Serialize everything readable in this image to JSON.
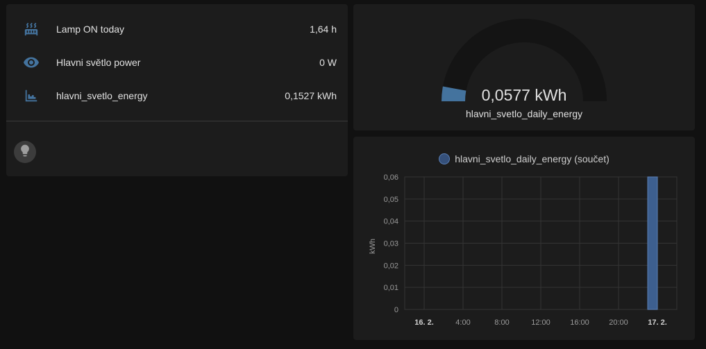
{
  "entities": {
    "rows": [
      {
        "name": "Lamp ON today",
        "state": "1,64 h",
        "icon": "radiator-icon"
      },
      {
        "name": "Hlavni světlo power",
        "state": "0 W",
        "icon": "eye-icon"
      },
      {
        "name": "hlavni_svetlo_energy",
        "state": "0,1527 kWh",
        "icon": "chart-step-icon"
      }
    ],
    "toggle_icon": "lightbulb-icon"
  },
  "gauge": {
    "value_text": "0,0577 kWh",
    "name": "hlavni_svetlo_daily_energy",
    "value": 0.0577,
    "min": 0,
    "max": 1
  },
  "chart": {
    "legend": "hlavni_svetlo_daily_energy (součet)",
    "ylabel": "kWh",
    "yticks": [
      "0",
      "0,01",
      "0,02",
      "0,03",
      "0,04",
      "0,05",
      "0,06"
    ],
    "xticks": [
      "16. 2.",
      "4:00",
      "8:00",
      "12:00",
      "16:00",
      "20:00",
      "17. 2."
    ],
    "bold_xticks": [
      "16. 2.",
      "17. 2."
    ]
  },
  "chart_data": {
    "type": "bar",
    "title": "",
    "series": [
      {
        "name": "hlavni_svetlo_daily_energy (součet)",
        "x": [
          "23:00"
        ],
        "values": [
          0.06
        ]
      }
    ],
    "xlabel": "",
    "ylabel": "kWh",
    "ylim": [
      0,
      0.06
    ],
    "grid": true,
    "legend": "top"
  },
  "colors": {
    "bar": "#3d5f8f",
    "bar_border": "#5a7fb6",
    "icon": "#44739e",
    "gauge_track": "#141414"
  }
}
